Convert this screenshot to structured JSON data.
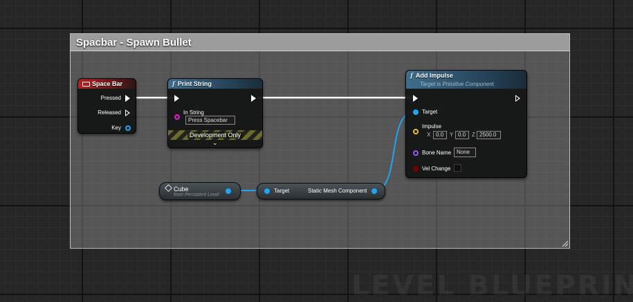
{
  "comment": {
    "title": "Spacbar - Spawn Bullet"
  },
  "watermark": "LEVEL BLUEPRINT",
  "space_bar_node": {
    "title": "Space Bar",
    "pins": {
      "pressed": "Pressed",
      "released": "Released",
      "key": "Key"
    }
  },
  "print_string_node": {
    "title": "Print String",
    "in_string_label": "In String",
    "in_string_value": "Press Spacebar",
    "dev_banner": "Development Only"
  },
  "add_impulse_node": {
    "title": "Add Impulse",
    "subtitle": "Target is Primitive Component",
    "target_label": "Target",
    "impulse_label": "Impulse",
    "impulse": {
      "x_label": "X",
      "x": "0.0",
      "y_label": "Y",
      "y": "0.0",
      "z_label": "Z",
      "z": "2500.0"
    },
    "bone_name_label": "Bone Name",
    "bone_name_value": "None",
    "vel_change_label": "Vel Change"
  },
  "cube_node": {
    "title": "Cube",
    "subtitle": "from Persistent Level"
  },
  "get_component_node": {
    "target_label": "Target",
    "output_label": "Static Mesh Component"
  },
  "colors": {
    "exec_wire": "#ffffff",
    "object_wire": "#1fa6f2",
    "event_header": "#b52323",
    "function_header": "#3e6e8e",
    "string_pin": "#e21cc8",
    "vector_pin": "#f0c020",
    "name_pin": "#9a5cf0",
    "bool_pin": "#7a0000"
  },
  "icons": {
    "event": "keyboard-icon",
    "function": "function-icon",
    "actor_reference": "cube-icon"
  }
}
